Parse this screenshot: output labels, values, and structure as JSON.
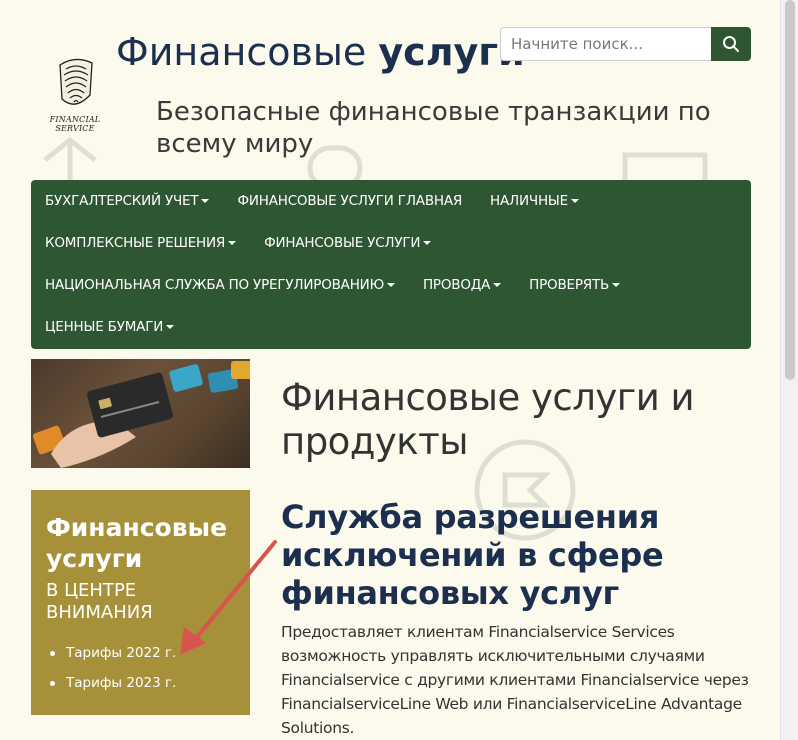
{
  "header": {
    "logo_caption": "FINANCIAL SERVICE",
    "title_normal": "Финансовые",
    "title_bold": "услуги",
    "tagline": "Безопасные финансовые транзакции по всему миру"
  },
  "search": {
    "placeholder": "Начните поиск..."
  },
  "nav": {
    "rows": [
      [
        "БУХГАЛТЕРСКИЙ УЧЕТ",
        "ФИНАНСОВЫЕ УСЛУГИ ГЛАВНАЯ",
        "НАЛИЧНЫЕ"
      ],
      [
        "КОМПЛЕКСНЫЕ РЕШЕНИЯ",
        "ФИНАНСОВЫЕ УСЛУГИ"
      ],
      [
        "НАЦИОНАЛЬНАЯ СЛУЖБА ПО УРЕГУЛИРОВАНИЮ",
        "ПРОВОДА",
        "ПРОВЕРЯТЬ"
      ],
      [
        "ЦЕННЫЕ БУМАГИ"
      ]
    ]
  },
  "spotlight": {
    "title": "Финансовые услуги",
    "subtitle": "В ЦЕНТРЕ ВНИМАНИЯ",
    "links": [
      "Тарифы 2022 г.",
      "Тарифы 2023 г."
    ]
  },
  "main": {
    "page_title": "Финансовые услуги и продукты",
    "section_heading": "Служба разрешения исключений в сфере финансовых услуг",
    "section_body": "Предоставляет клиентам Financialservice Services возможность управлять исключительными случаями Financialservice с другими клиентами Financialservice через FinancialserviceLine Web или FinancialserviceLine Advantage Solutions."
  },
  "colors": {
    "background": "#fbfaec",
    "nav_green": "#2f5633",
    "spotlight_gold": "#a6913a",
    "heading_navy": "#1c2f4f",
    "annotation_arrow": "#d9534f"
  }
}
